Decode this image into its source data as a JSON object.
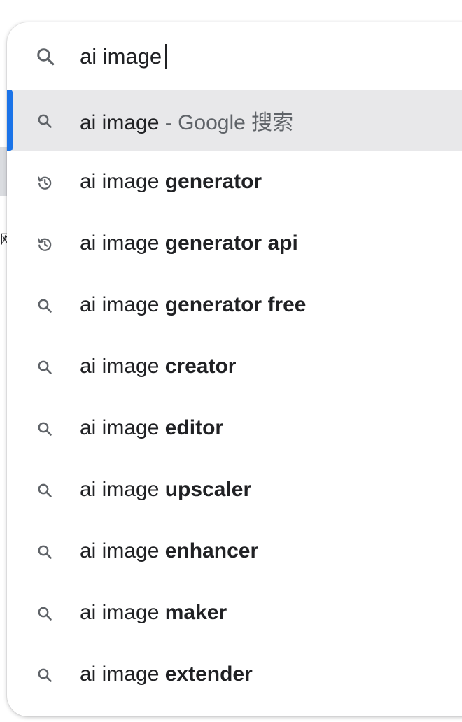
{
  "background": {
    "partial_glyph": "网"
  },
  "omnibox": {
    "icon": "search-icon",
    "value": "ai image"
  },
  "suggestions": [
    {
      "icon": "search-icon",
      "prefix": "ai image",
      "separator": " - ",
      "engine": "Google 搜索",
      "selected": true
    },
    {
      "icon": "history-icon",
      "prefix": "ai image ",
      "completion": "generator"
    },
    {
      "icon": "history-icon",
      "prefix": "ai image ",
      "completion": "generator api"
    },
    {
      "icon": "search-icon",
      "prefix": "ai image ",
      "completion": "generator free"
    },
    {
      "icon": "search-icon",
      "prefix": "ai image ",
      "completion": "creator"
    },
    {
      "icon": "search-icon",
      "prefix": "ai image ",
      "completion": "editor"
    },
    {
      "icon": "search-icon",
      "prefix": "ai image ",
      "completion": "upscaler"
    },
    {
      "icon": "search-icon",
      "prefix": "ai image ",
      "completion": "enhancer"
    },
    {
      "icon": "search-icon",
      "prefix": "ai image ",
      "completion": "maker"
    },
    {
      "icon": "search-icon",
      "prefix": "ai image ",
      "completion": "extender"
    }
  ],
  "colors": {
    "accent": "#1a73e8",
    "selected_row": "#e8e8ea",
    "icon": "#5f6368",
    "text": "#202124"
  }
}
